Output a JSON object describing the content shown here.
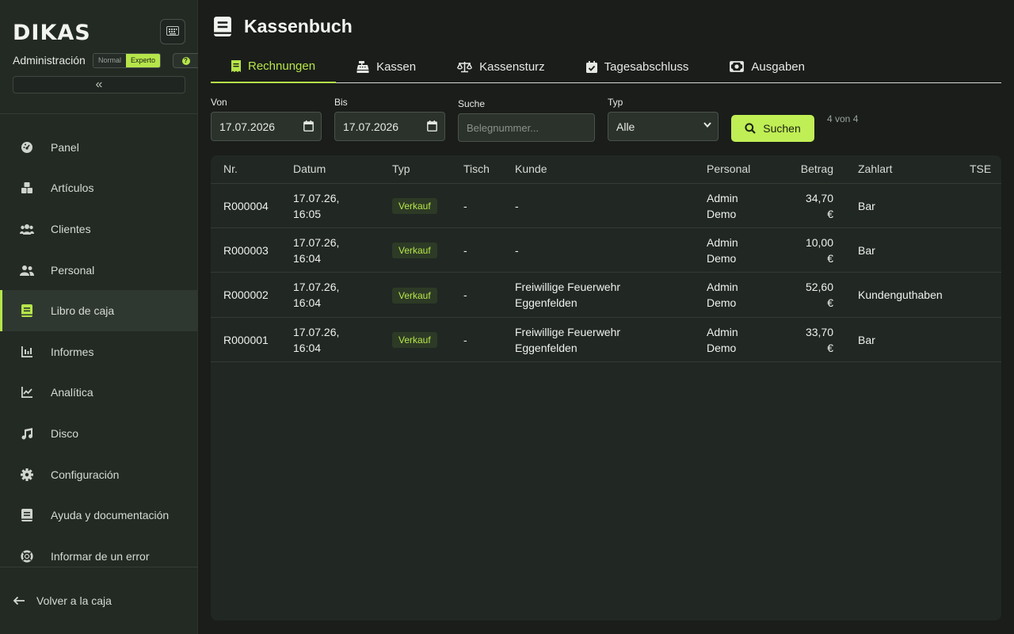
{
  "sidebar": {
    "logo": "DIKAS",
    "role": "Administración",
    "modes": [
      "Normal",
      "Experto"
    ],
    "active_mode": "Experto",
    "collapse_glyph": "«",
    "items": [
      {
        "label": "Panel",
        "icon": "dashboard-icon"
      },
      {
        "label": "Artículos",
        "icon": "boxes-icon"
      },
      {
        "label": "Clientes",
        "icon": "users-icon"
      },
      {
        "label": "Personal",
        "icon": "user-group-icon"
      },
      {
        "label": "Libro de caja",
        "icon": "book-icon",
        "active": true
      },
      {
        "label": "Informes",
        "icon": "bar-chart-icon"
      },
      {
        "label": "Analítica",
        "icon": "line-chart-icon"
      },
      {
        "label": "Disco",
        "icon": "music-icon"
      },
      {
        "label": "Configuración",
        "icon": "gear-icon"
      },
      {
        "label": "Ayuda y documentación",
        "icon": "book-icon"
      },
      {
        "label": "Informar de un error",
        "icon": "lifebuoy-icon"
      }
    ],
    "back_label": "Volver a la caja"
  },
  "page": {
    "title": "Kassenbuch"
  },
  "tabs": [
    {
      "label": "Rechnungen",
      "icon": "receipt-icon",
      "active": true
    },
    {
      "label": "Kassen",
      "icon": "cash-register-icon"
    },
    {
      "label": "Kassensturz",
      "icon": "scale-icon"
    },
    {
      "label": "Tagesabschluss",
      "icon": "calendar-check-icon"
    },
    {
      "label": "Ausgaben",
      "icon": "money-bill-icon"
    }
  ],
  "filters": {
    "from_label": "Von",
    "from_value": "17.07.2026",
    "to_label": "Bis",
    "to_value": "17.07.2026",
    "search_label": "Suche",
    "search_placeholder": "Belegnummer...",
    "type_label": "Typ",
    "type_value": "Alle",
    "search_button": "Suchen",
    "count": "4 von 4"
  },
  "table": {
    "columns": [
      "Nr.",
      "Datum",
      "Typ",
      "Tisch",
      "Kunde",
      "Personal",
      "Betrag",
      "Zahlart",
      "TSE"
    ],
    "rows": [
      {
        "nr": "R000004",
        "date1": "17.07.26,",
        "date2": "16:05",
        "typ": "Verkauf",
        "tisch": "-",
        "kunde1": "-",
        "kunde2": "",
        "personal1": "Admin",
        "personal2": "Demo",
        "betrag1": "34,70",
        "betrag2": "€",
        "zahlart": "Bar"
      },
      {
        "nr": "R000003",
        "date1": "17.07.26,",
        "date2": "16:04",
        "typ": "Verkauf",
        "tisch": "-",
        "kunde1": "-",
        "kunde2": "",
        "personal1": "Admin",
        "personal2": "Demo",
        "betrag1": "10,00",
        "betrag2": "€",
        "zahlart": "Bar"
      },
      {
        "nr": "R000002",
        "date1": "17.07.26,",
        "date2": "16:04",
        "typ": "Verkauf",
        "tisch": "-",
        "kunde1": "Freiwillige Feuerwehr",
        "kunde2": "Eggenfelden",
        "personal1": "Admin",
        "personal2": "Demo",
        "betrag1": "52,60",
        "betrag2": "€",
        "zahlart": "Kundenguthaben"
      },
      {
        "nr": "R000001",
        "date1": "17.07.26,",
        "date2": "16:04",
        "typ": "Verkauf",
        "tisch": "-",
        "kunde1": "Freiwillige Feuerwehr",
        "kunde2": "Eggenfelden",
        "personal1": "Admin",
        "personal2": "Demo",
        "betrag1": "33,70",
        "betrag2": "€",
        "zahlart": "Bar"
      }
    ]
  },
  "colors": {
    "accent": "#b6e54a",
    "sidebar_bg": "#232a24",
    "main_bg": "#1a1d1a",
    "table_bg": "#212723"
  }
}
